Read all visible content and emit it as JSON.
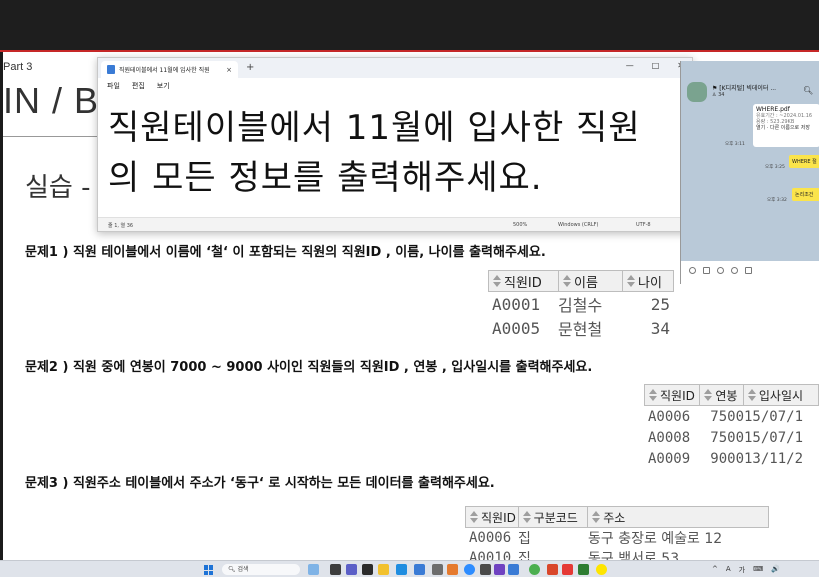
{
  "slide": {
    "part_label": "Part 3",
    "big_title": "IN / B",
    "practice": "실습 -",
    "questions": [
      "문제1 ) 직원 테이블에서 이름에 ‘철‘ 이 포함되는 직원의 직원ID , 이름, 나이를 출력해주세요.",
      "문제2 ) 직원 중에 연봉이 7000 ~ 9000 사이인 직원들의 직원ID , 연봉 , 입사일시를 출력해주세요.",
      "문제3 ) 직원주소 테이블에서 주소가 ‘동구‘ 로 시작하는 모든 데이터를 출력해주세요."
    ],
    "table1": {
      "headers": [
        "직원ID",
        "이름",
        "나이"
      ],
      "rows": [
        [
          "A0001",
          "김철수",
          "25"
        ],
        [
          "A0005",
          "문현철",
          "34"
        ]
      ]
    },
    "table2": {
      "headers": [
        "직원ID",
        "연봉",
        "입사일시"
      ],
      "rows": [
        [
          "A0006",
          "7500",
          "15/07/1"
        ],
        [
          "A0008",
          "7500",
          "15/07/1"
        ],
        [
          "A0009",
          "9000",
          "13/11/2"
        ]
      ]
    },
    "table3": {
      "headers": [
        "직원ID",
        "구분코드",
        "주소"
      ],
      "rows": [
        [
          "A0006",
          "집",
          "동구 충장로 예술로 12"
        ],
        [
          "A0010",
          "집",
          "동구 백서로 53"
        ]
      ]
    }
  },
  "notepad": {
    "tab_title": "직원테이블에서 11월에 입사한 직원",
    "tab_close": "×",
    "new_tab": "+",
    "window_buttons": [
      "—",
      "□",
      "✕"
    ],
    "menu": [
      "파일",
      "편집",
      "보기"
    ],
    "line1": "직원테이블에서 11월에 입사한 직원",
    "line2": "의 모든 정보를 출력해주세요.",
    "status": {
      "position": "줄 1, 열 36",
      "zoom": "500%",
      "line_ending": "Windows (CRLF)",
      "encoding": "UTF-8"
    }
  },
  "chat": {
    "title": "[K디지털] 빅데이터 ...",
    "member_count": "34",
    "file_name": "WHERE.pdf",
    "file_expiry": "유효기간 : ~2024.01.16",
    "file_size": "용량 : 523.29KB",
    "file_actions": "열기 · 다른 이름으로 저장",
    "times": [
      "오후 3:11",
      "오후 3:25",
      "오후 3:32"
    ],
    "bubble1": "WHERE 절",
    "bubble2": "논리조건"
  },
  "taskbar": {
    "search_placeholder": "검색",
    "tray": [
      "^",
      "A",
      "가",
      "⌨",
      "🔊"
    ]
  },
  "colors": {
    "accent_red": "#c62828",
    "chat_bg": "#b9c9d8",
    "bubble_yellow": "#fbe44b"
  }
}
